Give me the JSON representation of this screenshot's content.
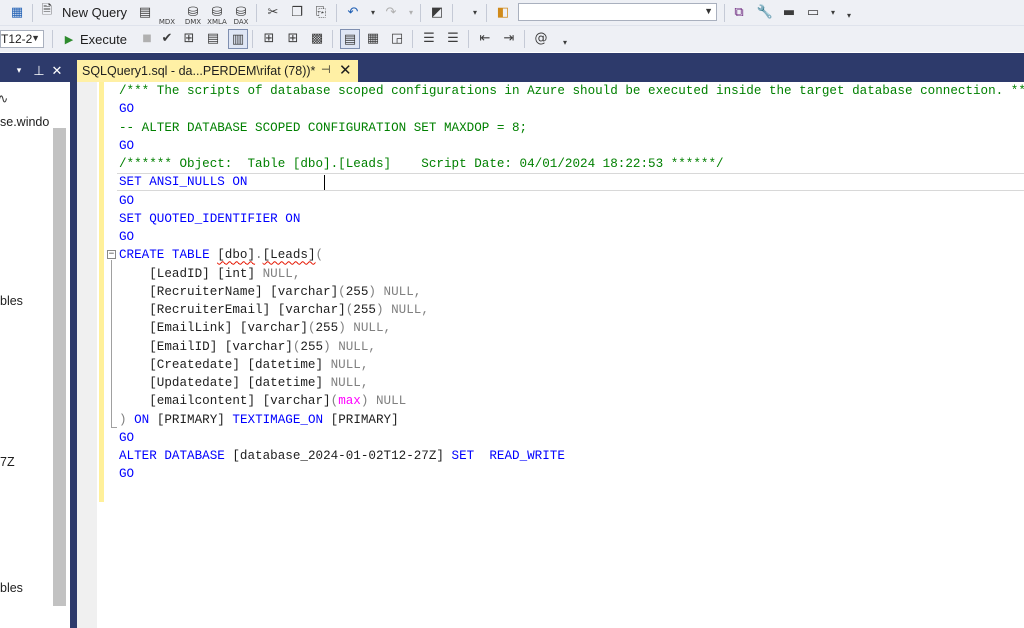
{
  "toolbar1": {
    "new_query_label": "New Query",
    "icons": [
      "connect-icon",
      "new-query-icon",
      "mdx-query-icon",
      "dmx-query-icon",
      "xmla-query-icon",
      "dax-query-icon",
      "cut-icon",
      "copy-icon",
      "paste-icon",
      "undo-icon",
      "redo-icon",
      "activity-monitor-icon",
      "solution-icon",
      "find-icon",
      "terminal-icon"
    ],
    "icon_labels": {
      "mdx": "MDX",
      "dmx": "DMX",
      "xmla": "XMLA",
      "dax": "DAX"
    },
    "search_value": ""
  },
  "toolbar2": {
    "database_value": "T12-2",
    "execute_label": "Execute"
  },
  "object_explorer": {
    "lines": [
      "se.windo",
      "bles",
      "7Z",
      "bles"
    ]
  },
  "tab": {
    "title": "SQLQuery1.sql - da...PERDEM\\rifat (78))*",
    "pin": "⊣",
    "close": "✕"
  },
  "code_lines": [
    [
      [
        "cm",
        "/*** The scripts of database scoped configurations in Azure should be executed inside the target database connection. ****"
      ]
    ],
    [
      [
        "kw",
        "GO"
      ]
    ],
    [
      [
        "cm",
        "-- ALTER DATABASE SCOPED CONFIGURATION SET MAXDOP = 8;"
      ]
    ],
    [
      [
        "kw",
        "GO"
      ]
    ],
    [
      [
        "cm",
        "/****** Object:  Table [dbo].[Leads]    Script Date: 04/01/2024 18:22:53 ******/"
      ]
    ],
    [
      [
        "kw",
        "SET ANSI_NULLS ON"
      ]
    ],
    [
      [
        "kw",
        "GO"
      ]
    ],
    [
      [
        "kw",
        "SET QUOTED_IDENTIFIER ON"
      ]
    ],
    [
      [
        "kw",
        "GO"
      ]
    ],
    [
      [
        "kw",
        "CREATE TABLE "
      ],
      [
        "sq",
        "[dbo]"
      ],
      [
        "gy",
        "."
      ],
      [
        "sq",
        "[Leads]"
      ],
      [
        "gy",
        "("
      ]
    ],
    [
      [
        "tx",
        "    [LeadID] [int] "
      ],
      [
        "gy",
        "NULL,"
      ]
    ],
    [
      [
        "tx",
        "    [RecruiterName] [varchar]"
      ],
      [
        "gy",
        "("
      ],
      [
        "tx",
        "255"
      ],
      [
        "gy",
        ") NULL,"
      ]
    ],
    [
      [
        "tx",
        "    [RecruiterEmail] [varchar]"
      ],
      [
        "gy",
        "("
      ],
      [
        "tx",
        "255"
      ],
      [
        "gy",
        ") NULL,"
      ]
    ],
    [
      [
        "tx",
        "    [EmailLink] [varchar]"
      ],
      [
        "gy",
        "("
      ],
      [
        "tx",
        "255"
      ],
      [
        "gy",
        ") NULL,"
      ]
    ],
    [
      [
        "tx",
        "    [EmailID] [varchar]"
      ],
      [
        "gy",
        "("
      ],
      [
        "tx",
        "255"
      ],
      [
        "gy",
        ") NULL,"
      ]
    ],
    [
      [
        "tx",
        "    [Createdate] [datetime] "
      ],
      [
        "gy",
        "NULL,"
      ]
    ],
    [
      [
        "tx",
        "    [Updatedate] [datetime] "
      ],
      [
        "gy",
        "NULL,"
      ]
    ],
    [
      [
        "tx",
        "    [emailcontent] [varchar]"
      ],
      [
        "gy",
        "("
      ],
      [
        "fn",
        "max"
      ],
      [
        "gy",
        ") NULL"
      ]
    ],
    [
      [
        "gy",
        ") "
      ],
      [
        "kw",
        "ON "
      ],
      [
        "tx",
        "[PRIMARY] "
      ],
      [
        "kw",
        "TEXTIMAGE_ON "
      ],
      [
        "tx",
        "[PRIMARY]"
      ]
    ],
    [
      [
        "kw",
        "GO"
      ]
    ],
    [
      [
        "kw",
        "ALTER DATABASE "
      ],
      [
        "tx",
        "[database_2024-01-02T12-27Z] "
      ],
      [
        "kw",
        "SET  READ_WRITE"
      ]
    ],
    [
      [
        "kw",
        "GO"
      ]
    ]
  ]
}
